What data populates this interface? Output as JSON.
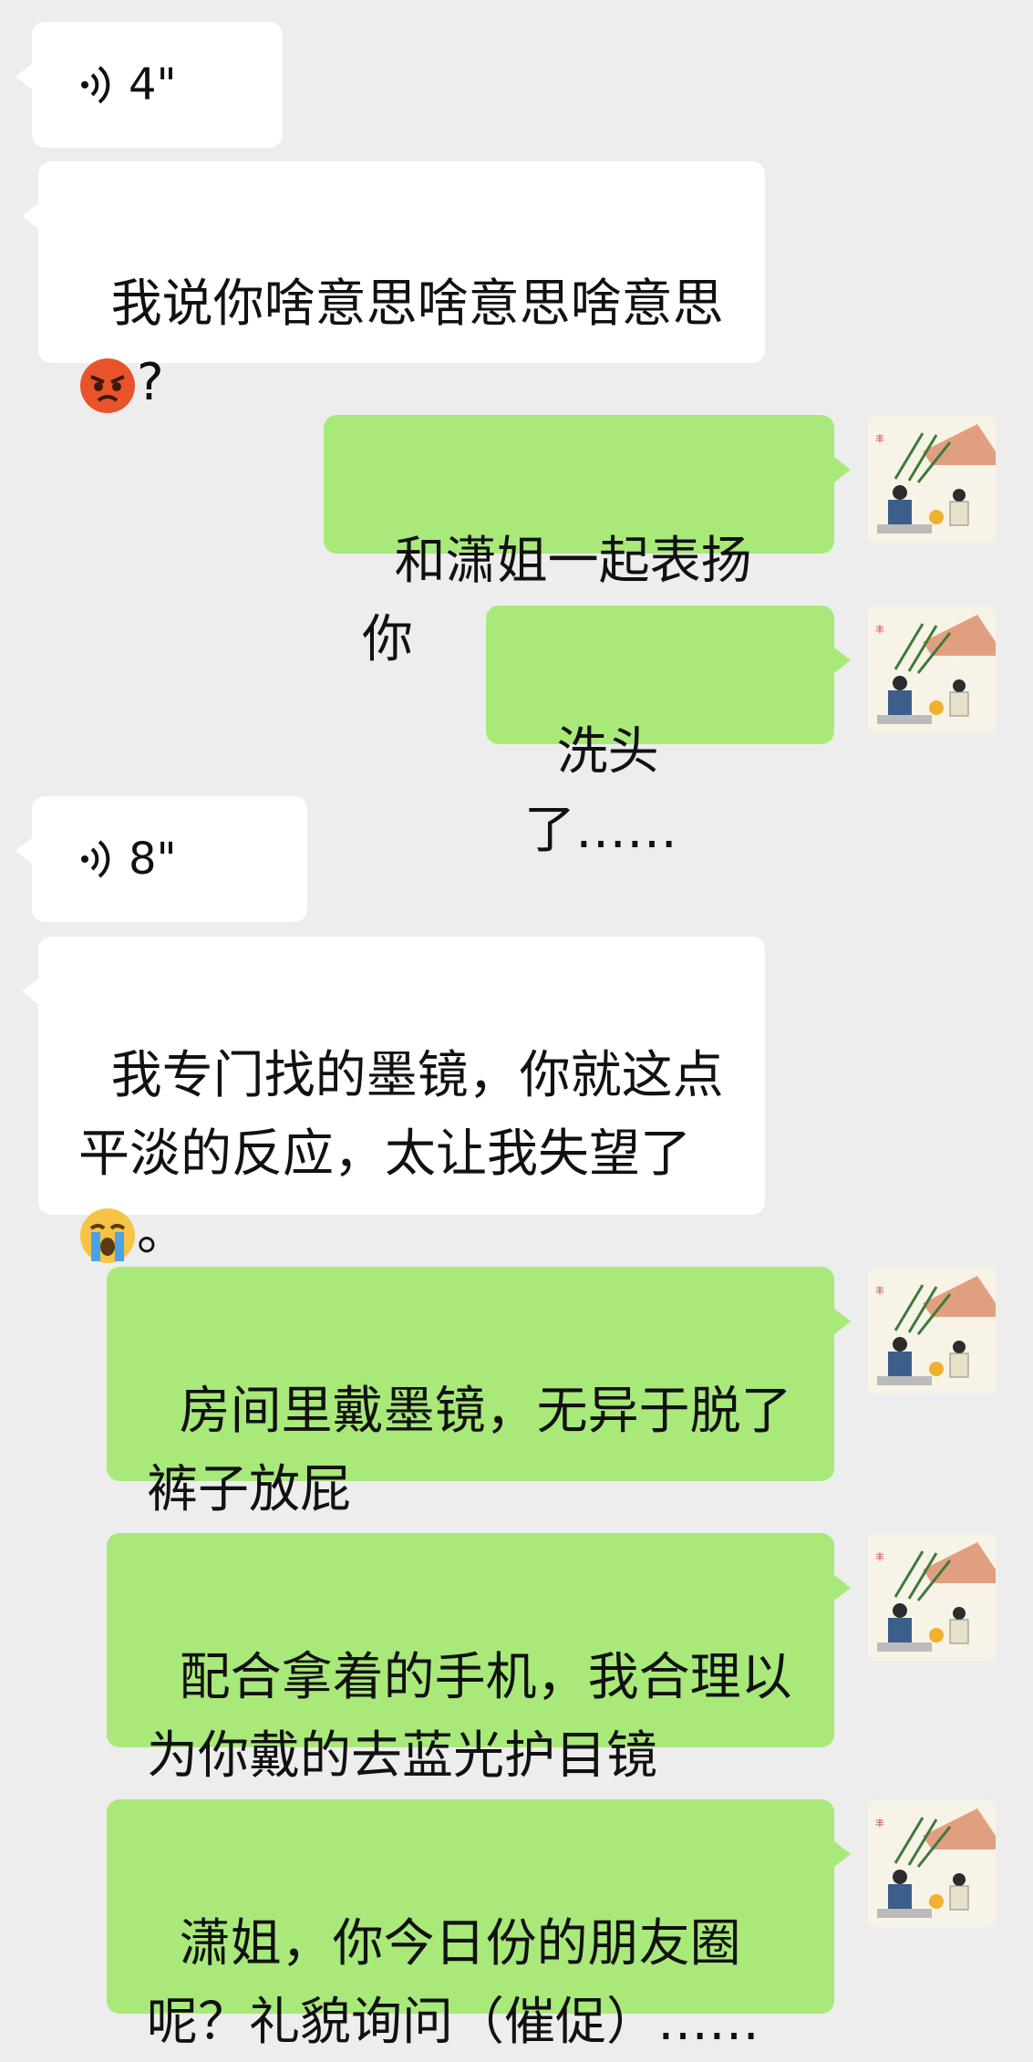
{
  "messages": [
    {
      "type": "voice",
      "side": "left",
      "duration": "4\""
    },
    {
      "type": "text",
      "side": "left",
      "text": "我说你啥意思啥意思啥意思\n",
      "emoji": "angry-face-emoji",
      "suffix": "?"
    },
    {
      "type": "text",
      "side": "right",
      "text": "和潇姐一起表扬你"
    },
    {
      "type": "text",
      "side": "right",
      "text": "洗头了……"
    },
    {
      "type": "voice",
      "side": "left",
      "duration": "8\""
    },
    {
      "type": "text",
      "side": "left",
      "text": "我专门找的墨镜，你就这点\n平淡的反应，太让我失望了\n",
      "emoji": "crying-face-emoji",
      "suffix": "。"
    },
    {
      "type": "text",
      "side": "right",
      "text": "房间里戴墨镜，无异于脱了\n裤子放屁"
    },
    {
      "type": "text",
      "side": "right",
      "text": "配合拿着的手机，我合理以\n为你戴的去蓝光护目镜"
    },
    {
      "type": "text",
      "side": "right",
      "text": "潇姐，你今日份的朋友圈\n呢？礼貌询问（催促）……"
    }
  ],
  "colors": {
    "background": "#ededed",
    "left_bubble": "#ffffff",
    "right_bubble": "#a9e97a"
  }
}
